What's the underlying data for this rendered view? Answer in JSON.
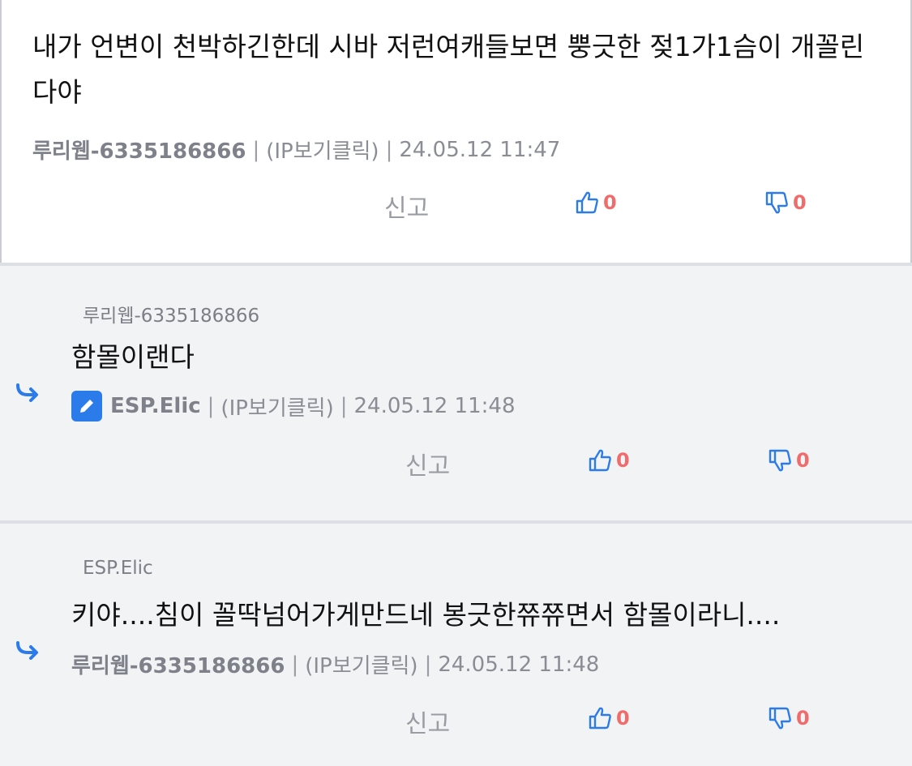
{
  "main_comment": {
    "text": "내가 언변이 천박하긴한데  시바 저런여캐들보면 뿡긋한 젖1가1슴이 개꼴린다야",
    "author": "루리웹-6335186866",
    "ip_label": "(IP보기클릭)",
    "date": "24.05.12 11:47",
    "report_label": "신고",
    "likes": "0",
    "dislikes": "0"
  },
  "replies": [
    {
      "reply_to": "루리웹-6335186866",
      "text": "함몰이랜다",
      "author": "ESP.Elic",
      "ip_label": "(IP보기클릭)",
      "date": "24.05.12 11:48",
      "report_label": "신고",
      "likes": "0",
      "dislikes": "0"
    },
    {
      "reply_to": "ESP.Elic",
      "text": "키야....침이 꼴딱넘어가게만드네 봉긋한쮸쮸면서 함몰이라니....",
      "author": "루리웹-6335186866",
      "ip_label": "(IP보기클릭)",
      "date": "24.05.12 11:48",
      "report_label": "신고",
      "likes": "0",
      "dislikes": "0"
    }
  ],
  "separator": "|",
  "colors": {
    "accent_blue": "#2b7bea",
    "count_red": "#f06b6b",
    "reply_bg": "#f2f3f5"
  },
  "icons": {
    "like": "thumbs-up-icon",
    "dislike": "thumbs-down-icon",
    "reply_arrow": "reply-arrow-icon",
    "edit_badge": "pencil-icon"
  }
}
